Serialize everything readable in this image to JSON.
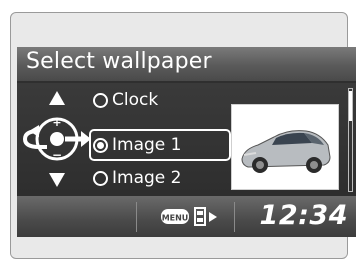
{
  "screen": {
    "title": "Select wallpaper",
    "options": [
      {
        "label": "Clock",
        "selected": false
      },
      {
        "label": "Image 1",
        "selected": true
      },
      {
        "label": "Image 2",
        "selected": false
      }
    ],
    "bottombar": {
      "menu_label": "MENU",
      "clock": "12:34"
    }
  }
}
